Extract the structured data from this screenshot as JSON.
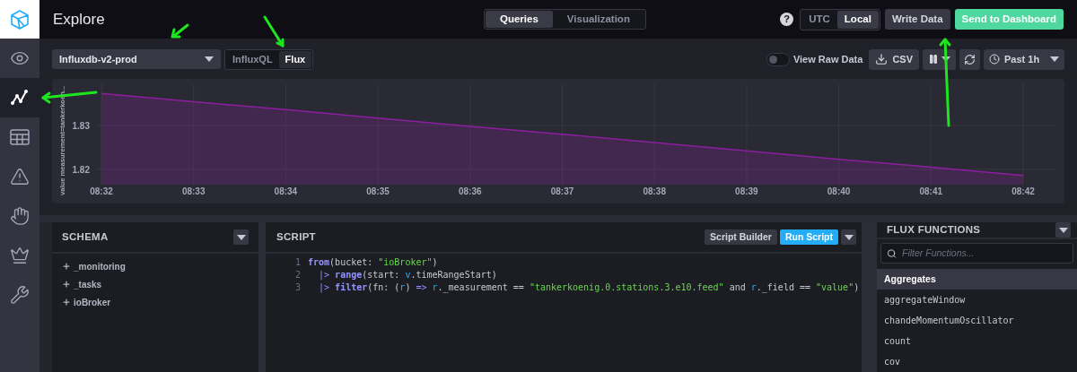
{
  "header": {
    "title": "Explore",
    "view_tabs": [
      {
        "label": "Queries",
        "selected": true
      },
      {
        "label": "Visualization",
        "selected": false
      }
    ],
    "help": "?",
    "timezone": [
      {
        "label": "UTC",
        "selected": false
      },
      {
        "label": "Local",
        "selected": true
      }
    ],
    "write_data": "Write Data",
    "send_to_dashboard": "Send to Dashboard"
  },
  "sidebar": {
    "items": [
      {
        "kind": "eye",
        "selected": false
      },
      {
        "kind": "graph",
        "selected": true
      },
      {
        "kind": "table",
        "selected": false
      },
      {
        "kind": "alert",
        "selected": false
      },
      {
        "kind": "hand",
        "selected": false
      },
      {
        "kind": "crown",
        "selected": false
      },
      {
        "kind": "wrench",
        "selected": false
      }
    ]
  },
  "query_bar": {
    "source": "Influxdb-v2-prod",
    "languages": [
      {
        "label": "InfluxQL",
        "selected": false
      },
      {
        "label": "Flux",
        "selected": true
      }
    ],
    "view_raw_data": {
      "label": "View Raw Data",
      "on": false
    },
    "csv": "CSV",
    "time_range": "Past 1h"
  },
  "graph": {
    "chart_data": {
      "type": "area",
      "ylabel": "value measurement=tankerkoen...",
      "categories": [
        "08:32",
        "08:33",
        "08:34",
        "08:35",
        "08:36",
        "08:37",
        "08:38",
        "08:39",
        "08:40",
        "08:41",
        "08:42"
      ],
      "series": [
        {
          "color": "#8e1ea0",
          "values": [
            1.8373,
            1.8354,
            1.8336,
            1.8317,
            1.8298,
            1.828,
            1.8261,
            1.8242,
            1.8223,
            1.8205,
            1.8186
          ]
        }
      ],
      "ylim": [
        1.8165,
        1.8394
      ],
      "grid": true,
      "yticks": [
        1.82,
        1.83
      ]
    }
  },
  "schema": {
    "title": "SCHEMA",
    "buckets": [
      {
        "label": "_monitoring",
        "expanded": false
      },
      {
        "label": "_tasks",
        "expanded": false
      },
      {
        "label": "ioBroker",
        "expanded": false
      }
    ]
  },
  "script": {
    "title": "SCRIPT",
    "script_builder": "Script Builder",
    "run_script": "Run Script",
    "lines": [
      {
        "number": "1",
        "tokens": [
          {
            "text": "from",
            "kind": "fn"
          },
          {
            "text": "(bucket: ",
            "kind": "text"
          },
          {
            "text": "\"ioBroker\"",
            "kind": "str"
          },
          {
            "text": ")",
            "kind": "text"
          }
        ]
      },
      {
        "number": "2",
        "tokens": [
          {
            "text": "  |> ",
            "kind": "op"
          },
          {
            "text": "range",
            "kind": "fn"
          },
          {
            "text": "(start: ",
            "kind": "text"
          },
          {
            "text": "v",
            "kind": "var"
          },
          {
            "text": ".timeRangeStart)",
            "kind": "text"
          }
        ]
      },
      {
        "number": "3",
        "tokens": [
          {
            "text": "  |> ",
            "kind": "op"
          },
          {
            "text": "filter",
            "kind": "fn"
          },
          {
            "text": "(fn: (",
            "kind": "text"
          },
          {
            "text": "r",
            "kind": "var"
          },
          {
            "text": ") ",
            "kind": "text"
          },
          {
            "text": "=> ",
            "kind": "op"
          },
          {
            "text": "r",
            "kind": "var"
          },
          {
            "text": "._measurement == ",
            "kind": "text"
          },
          {
            "text": "\"tankerkoenig.0.stations.3.e10.feed\"",
            "kind": "str"
          },
          {
            "text": " and ",
            "kind": "text"
          },
          {
            "text": "r",
            "kind": "var"
          },
          {
            "text": "._field == ",
            "kind": "text"
          },
          {
            "text": "\"value\"",
            "kind": "str"
          },
          {
            "text": ")",
            "kind": "text"
          }
        ]
      }
    ]
  },
  "flux_functions": {
    "title": "FLUX FUNCTIONS",
    "search_placeholder": "Filter Functions...",
    "categories": [
      {
        "label": "Aggregates",
        "functions": [
          "aggregateWindow",
          "chandeMomentumOscillator",
          "count",
          "cov"
        ]
      }
    ]
  }
}
